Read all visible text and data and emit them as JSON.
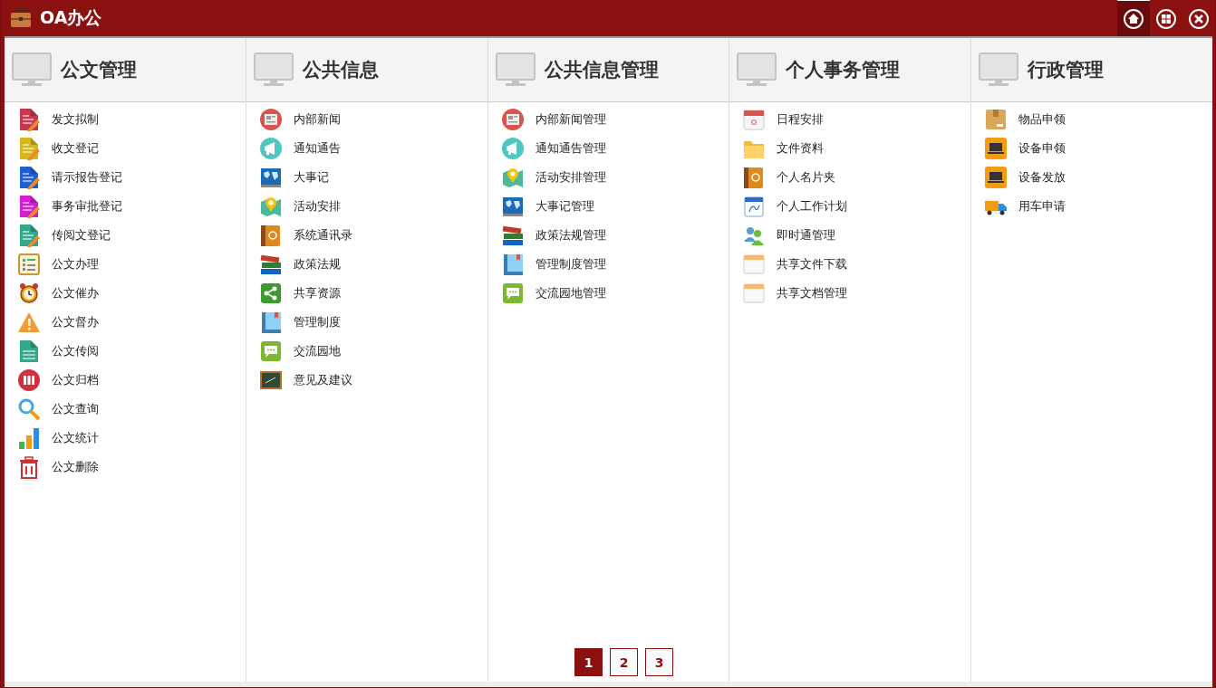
{
  "window": {
    "title": "OA办公"
  },
  "title_buttons": [
    {
      "kind": "home",
      "selected": true
    },
    {
      "kind": "grid",
      "selected": false
    },
    {
      "kind": "close",
      "selected": false
    }
  ],
  "columns": [
    {
      "title": "公文管理",
      "items": [
        {
          "label": "发文拟制",
          "kind": "document",
          "color": "#c8364f"
        },
        {
          "label": "收文登记",
          "kind": "document",
          "color": "#d4b81c"
        },
        {
          "label": "请示报告登记",
          "kind": "document",
          "color": "#1e5fd6"
        },
        {
          "label": "事务审批登记",
          "kind": "document",
          "color": "#d01ed0"
        },
        {
          "label": "传阅文登记",
          "kind": "document",
          "color": "#33a88c"
        },
        {
          "label": "公文办理",
          "kind": "list"
        },
        {
          "label": "公文催办",
          "kind": "clock"
        },
        {
          "label": "公文督办",
          "kind": "warning"
        },
        {
          "label": "公文传阅",
          "kind": "page"
        },
        {
          "label": "公文归档",
          "kind": "binders"
        },
        {
          "label": "公文查询",
          "kind": "search"
        },
        {
          "label": "公文统计",
          "kind": "chart"
        },
        {
          "label": "公文删除",
          "kind": "trash"
        }
      ]
    },
    {
      "title": "公共信息",
      "items": [
        {
          "label": "内部新闻",
          "kind": "news"
        },
        {
          "label": "通知通告",
          "kind": "megaphone"
        },
        {
          "label": "大事记",
          "kind": "globe"
        },
        {
          "label": "活动安排",
          "kind": "map"
        },
        {
          "label": "系统通讯录",
          "kind": "addressbook"
        },
        {
          "label": "政策法规",
          "kind": "books"
        },
        {
          "label": "共享资源",
          "kind": "share"
        },
        {
          "label": "管理制度",
          "kind": "book"
        },
        {
          "label": "交流园地",
          "kind": "chat"
        },
        {
          "label": "意见及建议",
          "kind": "board"
        }
      ]
    },
    {
      "title": "公共信息管理",
      "items": [
        {
          "label": "内部新闻管理",
          "kind": "news"
        },
        {
          "label": "通知通告管理",
          "kind": "megaphone"
        },
        {
          "label": "活动安排管理",
          "kind": "map"
        },
        {
          "label": "大事记管理",
          "kind": "globe"
        },
        {
          "label": "政策法规管理",
          "kind": "books"
        },
        {
          "label": "管理制度管理",
          "kind": "book"
        },
        {
          "label": "交流园地管理",
          "kind": "chat"
        }
      ]
    },
    {
      "title": "个人事务管理",
      "items": [
        {
          "label": "日程安排",
          "kind": "calendar"
        },
        {
          "label": "文件资料",
          "kind": "folder"
        },
        {
          "label": "个人名片夹",
          "kind": "addressbook"
        },
        {
          "label": "个人工作计划",
          "kind": "plan"
        },
        {
          "label": "即时通管理",
          "kind": "people"
        },
        {
          "label": "共享文件下载",
          "kind": "window"
        },
        {
          "label": "共享文档管理",
          "kind": "window"
        }
      ]
    },
    {
      "title": "行政管理",
      "items": [
        {
          "label": "物品申领",
          "kind": "box"
        },
        {
          "label": "设备申领",
          "kind": "laptop"
        },
        {
          "label": "设备发放",
          "kind": "laptop"
        },
        {
          "label": "用车申请",
          "kind": "truck"
        }
      ]
    }
  ],
  "pagination": [
    {
      "label": "1",
      "selected": true
    },
    {
      "label": "2",
      "selected": false
    },
    {
      "label": "3",
      "selected": false
    }
  ]
}
